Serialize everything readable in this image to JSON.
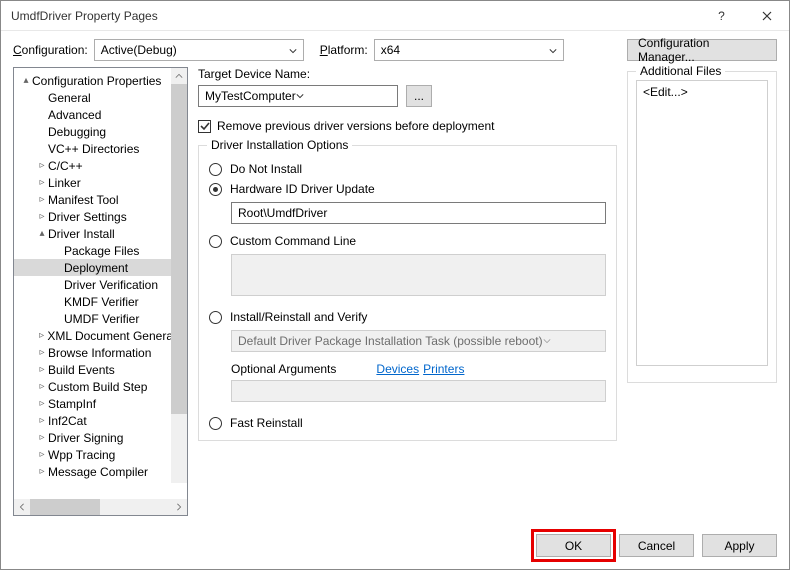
{
  "window": {
    "title": "UmdfDriver Property Pages"
  },
  "top": {
    "config_label": "Configuration:",
    "config_value": "Active(Debug)",
    "platform_label": "Platform:",
    "platform_value": "x64",
    "config_mgr": "Configuration Manager..."
  },
  "tree": [
    {
      "glyph": "▴",
      "indent": 0,
      "label": "Configuration Properties"
    },
    {
      "glyph": "",
      "indent": 1,
      "label": "General"
    },
    {
      "glyph": "",
      "indent": 1,
      "label": "Advanced"
    },
    {
      "glyph": "",
      "indent": 1,
      "label": "Debugging"
    },
    {
      "glyph": "",
      "indent": 1,
      "label": "VC++ Directories"
    },
    {
      "glyph": "▹",
      "indent": 1,
      "label": "C/C++"
    },
    {
      "glyph": "▹",
      "indent": 1,
      "label": "Linker"
    },
    {
      "glyph": "▹",
      "indent": 1,
      "label": "Manifest Tool"
    },
    {
      "glyph": "▹",
      "indent": 1,
      "label": "Driver Settings"
    },
    {
      "glyph": "▴",
      "indent": 1,
      "label": "Driver Install"
    },
    {
      "glyph": "",
      "indent": 2,
      "label": "Package Files"
    },
    {
      "glyph": "",
      "indent": 2,
      "label": "Deployment",
      "selected": true
    },
    {
      "glyph": "",
      "indent": 2,
      "label": "Driver Verification"
    },
    {
      "glyph": "",
      "indent": 2,
      "label": "KMDF Verifier"
    },
    {
      "glyph": "",
      "indent": 2,
      "label": "UMDF Verifier"
    },
    {
      "glyph": "▹",
      "indent": 1,
      "label": "XML Document Generator"
    },
    {
      "glyph": "▹",
      "indent": 1,
      "label": "Browse Information"
    },
    {
      "glyph": "▹",
      "indent": 1,
      "label": "Build Events"
    },
    {
      "glyph": "▹",
      "indent": 1,
      "label": "Custom Build Step"
    },
    {
      "glyph": "▹",
      "indent": 1,
      "label": "StampInf"
    },
    {
      "glyph": "▹",
      "indent": 1,
      "label": "Inf2Cat"
    },
    {
      "glyph": "▹",
      "indent": 1,
      "label": "Driver Signing"
    },
    {
      "glyph": "▹",
      "indent": 1,
      "label": "Wpp Tracing"
    },
    {
      "glyph": "▹",
      "indent": 1,
      "label": "Message Compiler"
    }
  ],
  "main": {
    "target_device_label": "Target Device Name:",
    "target_device_value": "MyTestComputer",
    "browse": "...",
    "remove_prev": "Remove previous driver versions before deployment",
    "remove_prev_checked": true,
    "groupbox_label": "Driver Installation Options",
    "opt_noinstall": "Do Not Install",
    "opt_hwid": "Hardware ID Driver Update",
    "opt_hwid_value": "Root\\UmdfDriver",
    "opt_custom": "Custom Command Line",
    "opt_install": "Install/Reinstall and Verify",
    "install_task": "Default Driver Package Installation Task (possible reboot)",
    "opt_args_label": "Optional Arguments",
    "link_devices": "Devices",
    "link_printers": "Printers",
    "opt_fast": "Fast Reinstall",
    "selected_option": "hwid"
  },
  "additional": {
    "label": "Additional Files",
    "edit": "<Edit...>"
  },
  "footer": {
    "ok": "OK",
    "cancel": "Cancel",
    "apply": "Apply"
  }
}
